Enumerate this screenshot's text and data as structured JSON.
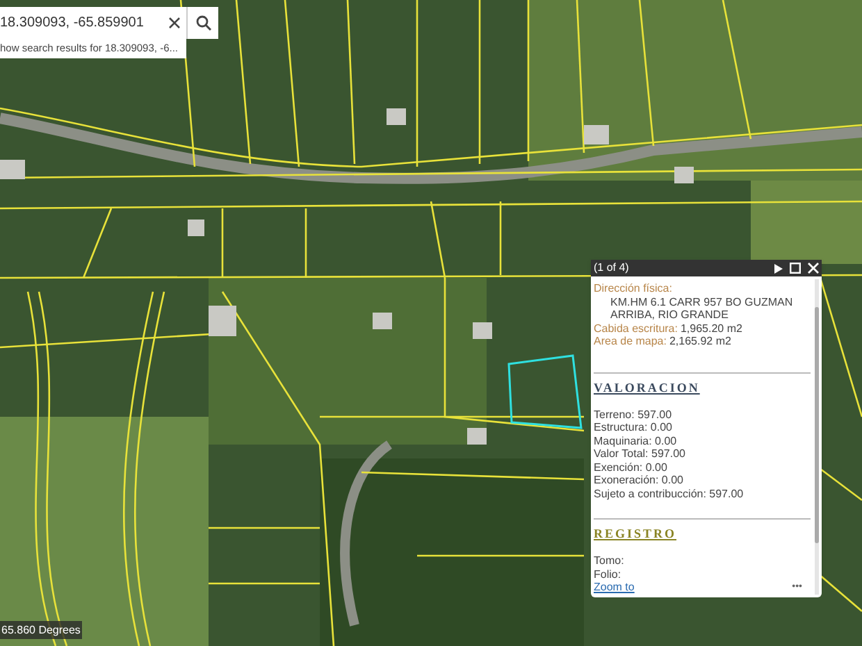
{
  "search": {
    "value": "18.309093, -65.859901",
    "suggestion": "how search results for 18.309093, -6..."
  },
  "popup": {
    "counter": "(1 of 4)",
    "fields": [
      {
        "kind": "block",
        "label": "Dirección física:",
        "value": "KM.HM 6.1 CARR 957 BO GUZMAN ARRIBA, RIO GRANDE"
      },
      {
        "kind": "inline",
        "label": "Cabida escritura:",
        "value": "1,965.20 m2"
      },
      {
        "kind": "inline",
        "label": "Area de mapa:",
        "value": "2,165.92 m2"
      }
    ],
    "sections": [
      {
        "title": "VALORACION",
        "color": "#3b4a5e",
        "lines": [
          "Terreno: 597.00",
          "Estructura: 0.00",
          "Maquinaria: 0.00",
          "Valor Total: 597.00",
          "Exención: 0.00",
          "Exoneración: 0.00",
          "Sujeto a contribucción: 597.00"
        ]
      },
      {
        "title": "REGISTRO",
        "color": "#8a8424",
        "lines": [
          "Tomo:",
          "Folio:"
        ]
      }
    ],
    "link": "Zoom to",
    "more": "•••"
  },
  "coordinates": "65.860 Degrees"
}
